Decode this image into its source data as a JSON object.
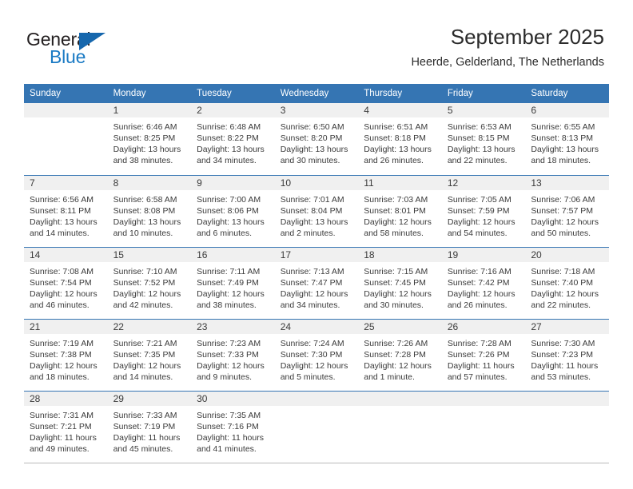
{
  "logo": {
    "word1": "General",
    "word2": "Blue",
    "triangle_color": "#1667ad",
    "word2_color": "#1a7ac4"
  },
  "header": {
    "title": "September 2025",
    "subtitle": "Heerde, Gelderland, The Netherlands"
  },
  "theme": {
    "header_bg": "#3575b3",
    "daynum_band_bg": "#f0f0f0",
    "text": "#3a3a3a"
  },
  "weekday_headers": [
    "Sunday",
    "Monday",
    "Tuesday",
    "Wednesday",
    "Thursday",
    "Friday",
    "Saturday"
  ],
  "weeks": [
    [
      {
        "day": "",
        "empty": true,
        "sunrise": "",
        "sunset": "",
        "daylight_1": "",
        "daylight_2": ""
      },
      {
        "day": "1",
        "sunrise": "Sunrise: 6:46 AM",
        "sunset": "Sunset: 8:25 PM",
        "daylight_1": "Daylight: 13 hours",
        "daylight_2": "and 38 minutes."
      },
      {
        "day": "2",
        "sunrise": "Sunrise: 6:48 AM",
        "sunset": "Sunset: 8:22 PM",
        "daylight_1": "Daylight: 13 hours",
        "daylight_2": "and 34 minutes."
      },
      {
        "day": "3",
        "sunrise": "Sunrise: 6:50 AM",
        "sunset": "Sunset: 8:20 PM",
        "daylight_1": "Daylight: 13 hours",
        "daylight_2": "and 30 minutes."
      },
      {
        "day": "4",
        "sunrise": "Sunrise: 6:51 AM",
        "sunset": "Sunset: 8:18 PM",
        "daylight_1": "Daylight: 13 hours",
        "daylight_2": "and 26 minutes."
      },
      {
        "day": "5",
        "sunrise": "Sunrise: 6:53 AM",
        "sunset": "Sunset: 8:15 PM",
        "daylight_1": "Daylight: 13 hours",
        "daylight_2": "and 22 minutes."
      },
      {
        "day": "6",
        "sunrise": "Sunrise: 6:55 AM",
        "sunset": "Sunset: 8:13 PM",
        "daylight_1": "Daylight: 13 hours",
        "daylight_2": "and 18 minutes."
      }
    ],
    [
      {
        "day": "7",
        "sunrise": "Sunrise: 6:56 AM",
        "sunset": "Sunset: 8:11 PM",
        "daylight_1": "Daylight: 13 hours",
        "daylight_2": "and 14 minutes."
      },
      {
        "day": "8",
        "sunrise": "Sunrise: 6:58 AM",
        "sunset": "Sunset: 8:08 PM",
        "daylight_1": "Daylight: 13 hours",
        "daylight_2": "and 10 minutes."
      },
      {
        "day": "9",
        "sunrise": "Sunrise: 7:00 AM",
        "sunset": "Sunset: 8:06 PM",
        "daylight_1": "Daylight: 13 hours",
        "daylight_2": "and 6 minutes."
      },
      {
        "day": "10",
        "sunrise": "Sunrise: 7:01 AM",
        "sunset": "Sunset: 8:04 PM",
        "daylight_1": "Daylight: 13 hours",
        "daylight_2": "and 2 minutes."
      },
      {
        "day": "11",
        "sunrise": "Sunrise: 7:03 AM",
        "sunset": "Sunset: 8:01 PM",
        "daylight_1": "Daylight: 12 hours",
        "daylight_2": "and 58 minutes."
      },
      {
        "day": "12",
        "sunrise": "Sunrise: 7:05 AM",
        "sunset": "Sunset: 7:59 PM",
        "daylight_1": "Daylight: 12 hours",
        "daylight_2": "and 54 minutes."
      },
      {
        "day": "13",
        "sunrise": "Sunrise: 7:06 AM",
        "sunset": "Sunset: 7:57 PM",
        "daylight_1": "Daylight: 12 hours",
        "daylight_2": "and 50 minutes."
      }
    ],
    [
      {
        "day": "14",
        "sunrise": "Sunrise: 7:08 AM",
        "sunset": "Sunset: 7:54 PM",
        "daylight_1": "Daylight: 12 hours",
        "daylight_2": "and 46 minutes."
      },
      {
        "day": "15",
        "sunrise": "Sunrise: 7:10 AM",
        "sunset": "Sunset: 7:52 PM",
        "daylight_1": "Daylight: 12 hours",
        "daylight_2": "and 42 minutes."
      },
      {
        "day": "16",
        "sunrise": "Sunrise: 7:11 AM",
        "sunset": "Sunset: 7:49 PM",
        "daylight_1": "Daylight: 12 hours",
        "daylight_2": "and 38 minutes."
      },
      {
        "day": "17",
        "sunrise": "Sunrise: 7:13 AM",
        "sunset": "Sunset: 7:47 PM",
        "daylight_1": "Daylight: 12 hours",
        "daylight_2": "and 34 minutes."
      },
      {
        "day": "18",
        "sunrise": "Sunrise: 7:15 AM",
        "sunset": "Sunset: 7:45 PM",
        "daylight_1": "Daylight: 12 hours",
        "daylight_2": "and 30 minutes."
      },
      {
        "day": "19",
        "sunrise": "Sunrise: 7:16 AM",
        "sunset": "Sunset: 7:42 PM",
        "daylight_1": "Daylight: 12 hours",
        "daylight_2": "and 26 minutes."
      },
      {
        "day": "20",
        "sunrise": "Sunrise: 7:18 AM",
        "sunset": "Sunset: 7:40 PM",
        "daylight_1": "Daylight: 12 hours",
        "daylight_2": "and 22 minutes."
      }
    ],
    [
      {
        "day": "21",
        "sunrise": "Sunrise: 7:19 AM",
        "sunset": "Sunset: 7:38 PM",
        "daylight_1": "Daylight: 12 hours",
        "daylight_2": "and 18 minutes."
      },
      {
        "day": "22",
        "sunrise": "Sunrise: 7:21 AM",
        "sunset": "Sunset: 7:35 PM",
        "daylight_1": "Daylight: 12 hours",
        "daylight_2": "and 14 minutes."
      },
      {
        "day": "23",
        "sunrise": "Sunrise: 7:23 AM",
        "sunset": "Sunset: 7:33 PM",
        "daylight_1": "Daylight: 12 hours",
        "daylight_2": "and 9 minutes."
      },
      {
        "day": "24",
        "sunrise": "Sunrise: 7:24 AM",
        "sunset": "Sunset: 7:30 PM",
        "daylight_1": "Daylight: 12 hours",
        "daylight_2": "and 5 minutes."
      },
      {
        "day": "25",
        "sunrise": "Sunrise: 7:26 AM",
        "sunset": "Sunset: 7:28 PM",
        "daylight_1": "Daylight: 12 hours",
        "daylight_2": "and 1 minute."
      },
      {
        "day": "26",
        "sunrise": "Sunrise: 7:28 AM",
        "sunset": "Sunset: 7:26 PM",
        "daylight_1": "Daylight: 11 hours",
        "daylight_2": "and 57 minutes."
      },
      {
        "day": "27",
        "sunrise": "Sunrise: 7:30 AM",
        "sunset": "Sunset: 7:23 PM",
        "daylight_1": "Daylight: 11 hours",
        "daylight_2": "and 53 minutes."
      }
    ],
    [
      {
        "day": "28",
        "sunrise": "Sunrise: 7:31 AM",
        "sunset": "Sunset: 7:21 PM",
        "daylight_1": "Daylight: 11 hours",
        "daylight_2": "and 49 minutes."
      },
      {
        "day": "29",
        "sunrise": "Sunrise: 7:33 AM",
        "sunset": "Sunset: 7:19 PM",
        "daylight_1": "Daylight: 11 hours",
        "daylight_2": "and 45 minutes."
      },
      {
        "day": "30",
        "sunrise": "Sunrise: 7:35 AM",
        "sunset": "Sunset: 7:16 PM",
        "daylight_1": "Daylight: 11 hours",
        "daylight_2": "and 41 minutes."
      },
      {
        "day": "",
        "empty": true,
        "sunrise": "",
        "sunset": "",
        "daylight_1": "",
        "daylight_2": ""
      },
      {
        "day": "",
        "empty": true,
        "sunrise": "",
        "sunset": "",
        "daylight_1": "",
        "daylight_2": ""
      },
      {
        "day": "",
        "empty": true,
        "sunrise": "",
        "sunset": "",
        "daylight_1": "",
        "daylight_2": ""
      },
      {
        "day": "",
        "empty": true,
        "sunrise": "",
        "sunset": "",
        "daylight_1": "",
        "daylight_2": ""
      }
    ]
  ]
}
